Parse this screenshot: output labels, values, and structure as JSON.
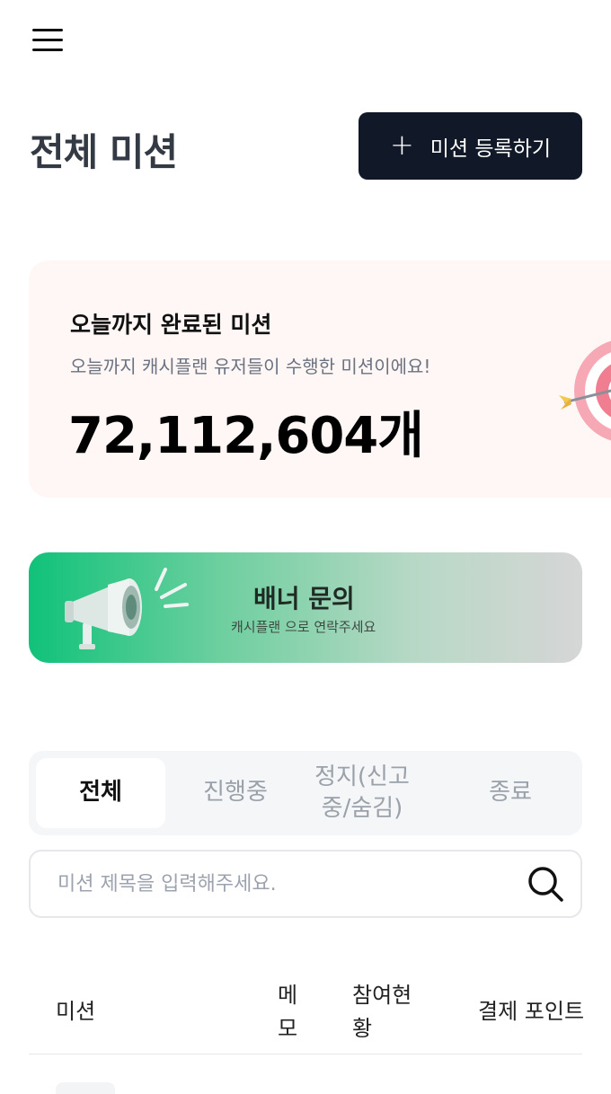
{
  "header": {
    "menu_icon": "hamburger-menu-icon"
  },
  "page": {
    "title": "전체 미션",
    "register_button_label": "미션 등록하기",
    "register_icon": "plus-icon"
  },
  "stats": {
    "title": "오늘까지 완료된 미션",
    "subtitle": "오늘까지 캐시플랜 유저들이 수행한 미션이에요!",
    "count": "72,112,604개",
    "icon": "target-arrow-icon"
  },
  "banner": {
    "title": "배너 문의",
    "subtitle": "캐시플랜 으로 연락주세요",
    "icon": "megaphone-icon"
  },
  "tabs": [
    {
      "label": "전체",
      "active": true
    },
    {
      "label": "진행중",
      "active": false
    },
    {
      "label": "정지(신고중/숨김)",
      "active": false
    },
    {
      "label": "종료",
      "active": false
    }
  ],
  "search": {
    "placeholder": "미션 제목을 입력해주세요.",
    "icon": "search-icon"
  },
  "table": {
    "columns": [
      "미션",
      "메모",
      "참여현황",
      "결제 포인트"
    ]
  },
  "colors": {
    "primary_dark": "#111827",
    "card_bg": "#fff6f6",
    "banner_green": "#10c27a"
  }
}
